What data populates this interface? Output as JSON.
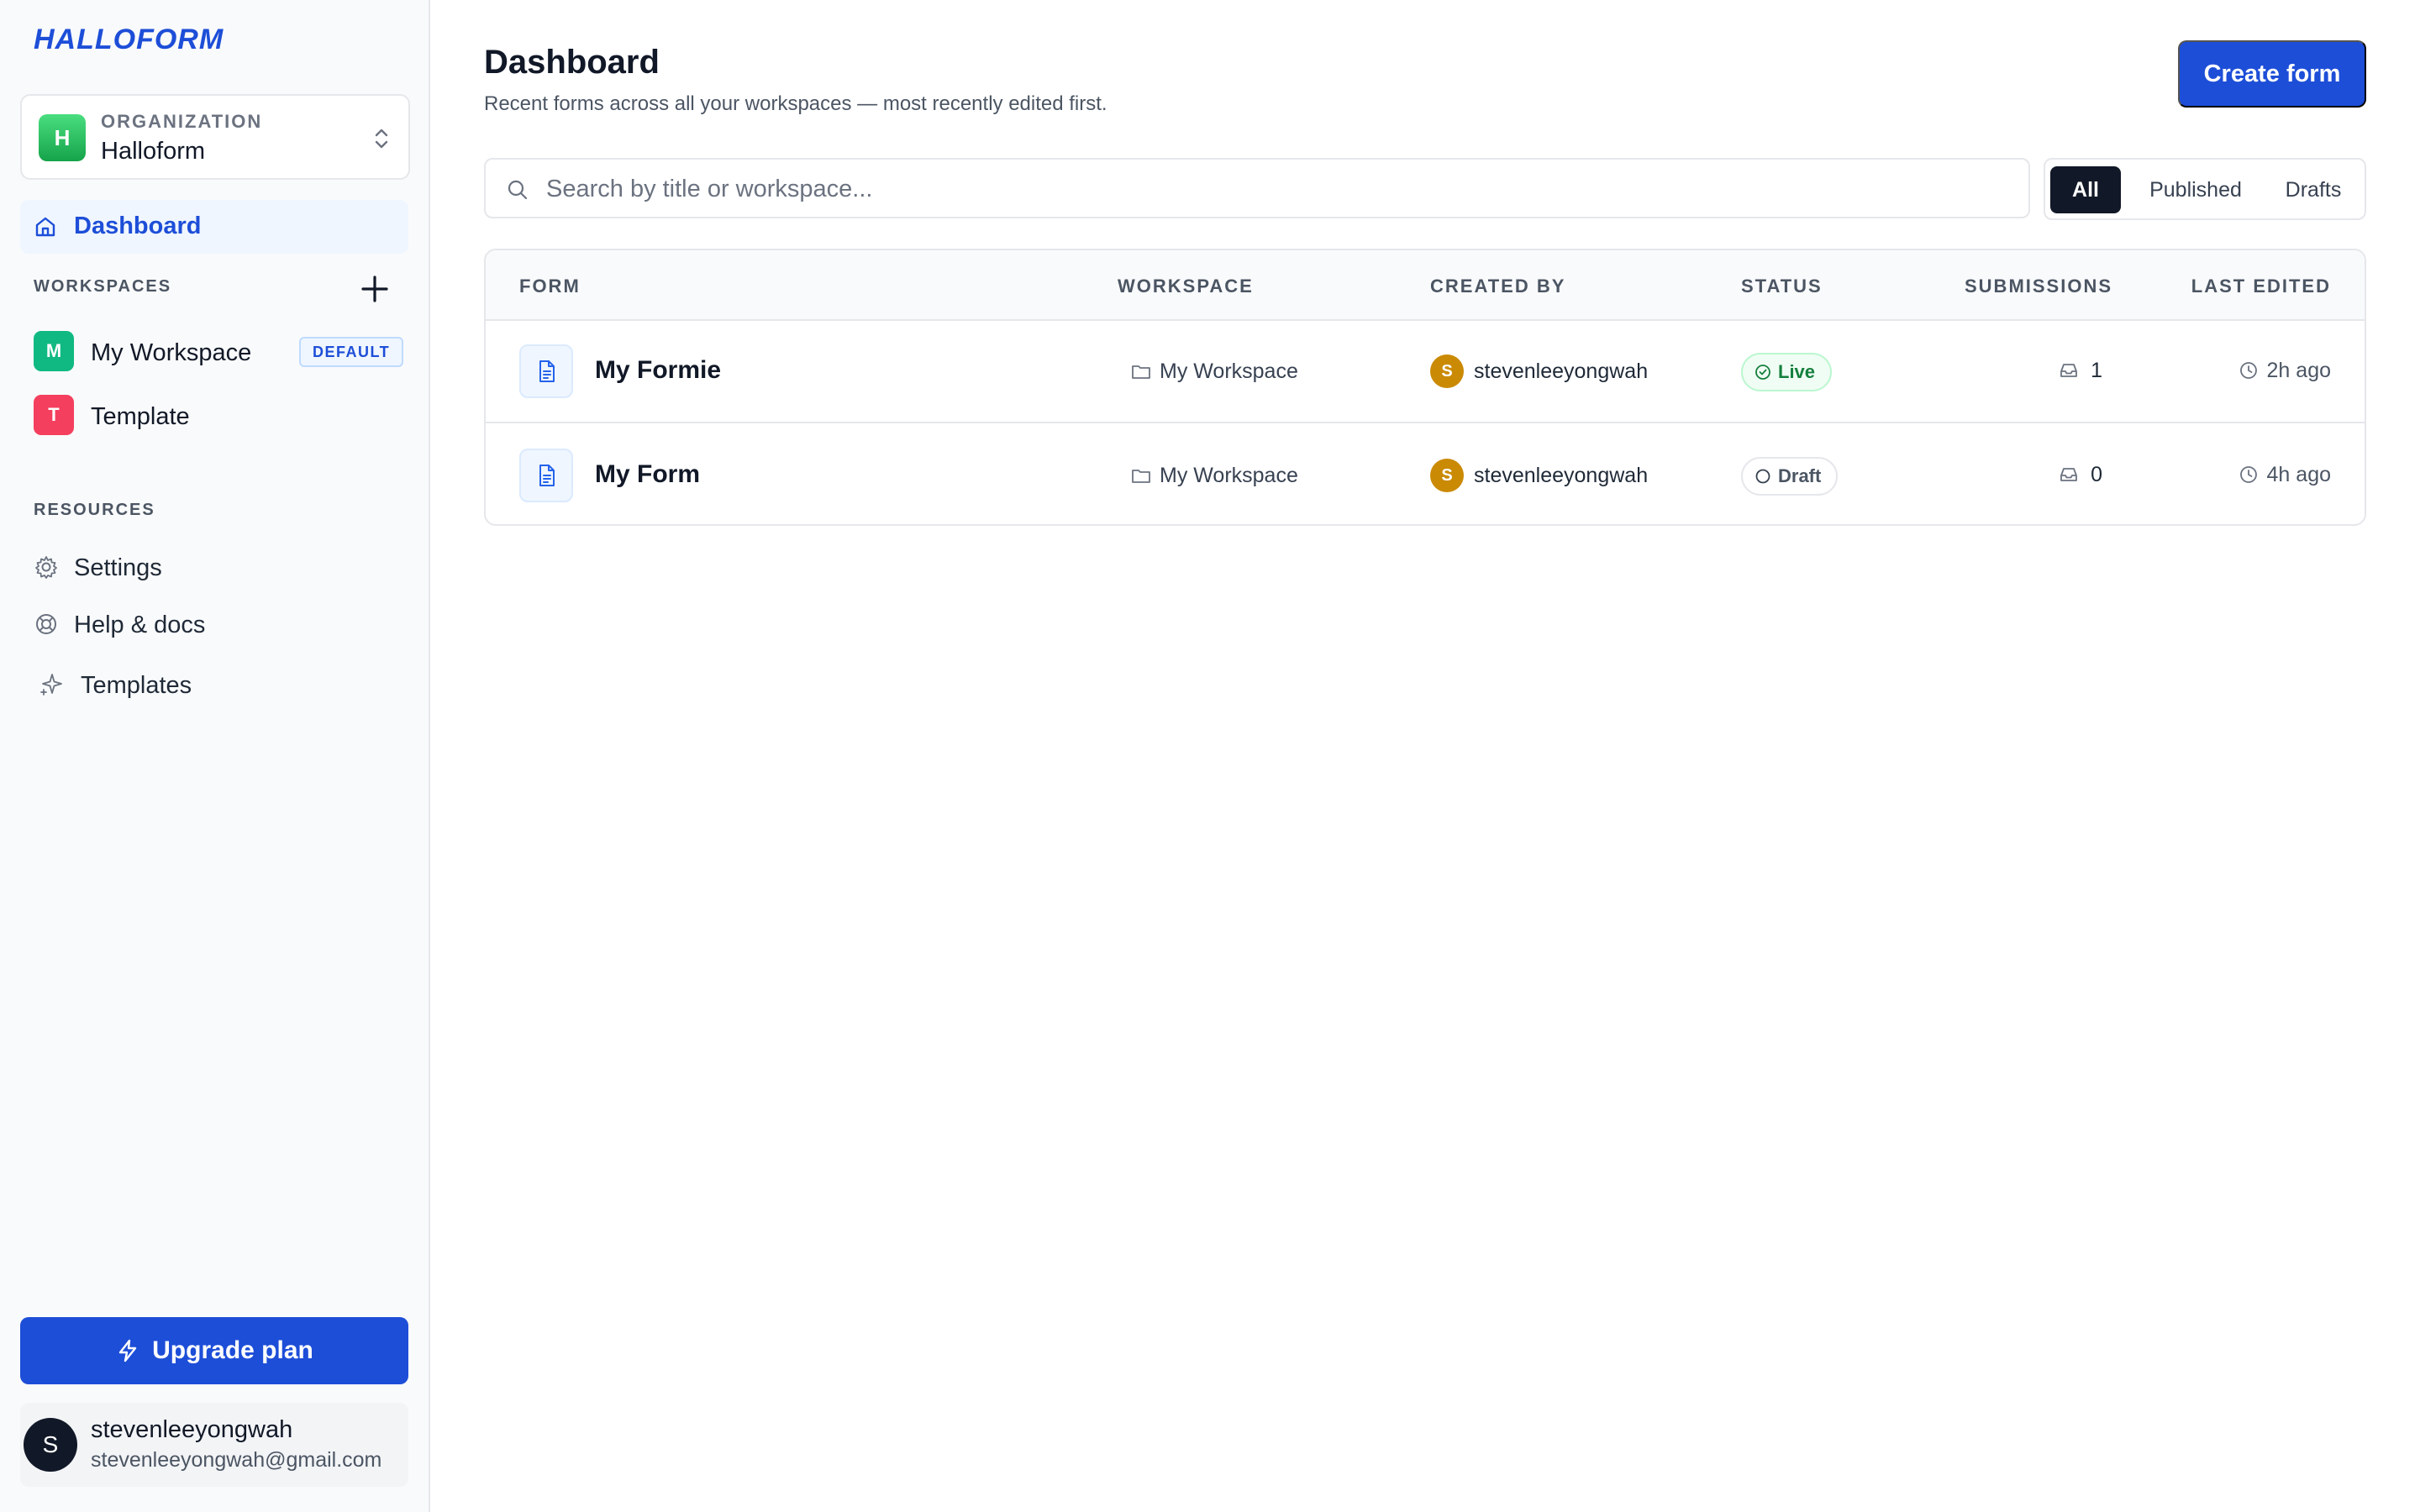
{
  "brand": {
    "logo_text": "HALLOFORM"
  },
  "org": {
    "label": "ORGANIZATION",
    "name": "Halloform",
    "avatar_letter": "H"
  },
  "nav": {
    "dashboard_label": "Dashboard"
  },
  "workspaces": {
    "section_label": "WORKSPACES",
    "items": [
      {
        "letter": "M",
        "label": "My Workspace",
        "badge": "DEFAULT",
        "color": "#10b981"
      },
      {
        "letter": "T",
        "label": "Template",
        "badge": "",
        "color": "#f43f5e"
      }
    ]
  },
  "resources": {
    "section_label": "RESOURCES",
    "items": [
      {
        "label": "Settings",
        "icon": "gear-icon"
      },
      {
        "label": "Help & docs",
        "icon": "lifebuoy-icon"
      },
      {
        "label": "Templates",
        "icon": "sparkle-icon"
      }
    ]
  },
  "upgrade": {
    "label": "Upgrade plan",
    "icon": "lightning-icon"
  },
  "user": {
    "avatar_letter": "S",
    "name": "stevenleeyongwah",
    "email": "stevenleeyongwah@gmail.com"
  },
  "header": {
    "title": "Dashboard",
    "subtitle": "Recent forms across all your workspaces — most recently edited first.",
    "create_label": "Create form"
  },
  "search": {
    "placeholder": "Search by title or workspace...",
    "value": ""
  },
  "filters": {
    "all": "All",
    "published": "Published",
    "drafts": "Drafts",
    "active": "All"
  },
  "table": {
    "headers": {
      "form": "FORM",
      "workspace": "WORKSPACE",
      "created_by": "CREATED BY",
      "status": "STATUS",
      "submissions": "SUBMISSIONS",
      "last_edited": "LAST EDITED"
    },
    "rows": [
      {
        "title": "My Formie",
        "workspace": "My Workspace",
        "creator_letter": "S",
        "creator": "stevenleeyongwah",
        "status": "Live",
        "submissions": "1",
        "last_edited": "2h ago"
      },
      {
        "title": "My Form",
        "workspace": "My Workspace",
        "creator_letter": "S",
        "creator": "stevenleeyongwah",
        "status": "Draft",
        "submissions": "0",
        "last_edited": "4h ago"
      }
    ]
  },
  "colors": {
    "accent": "#1d4ed8",
    "live": "#15803d",
    "creator_avatar": "#ca8a04"
  }
}
